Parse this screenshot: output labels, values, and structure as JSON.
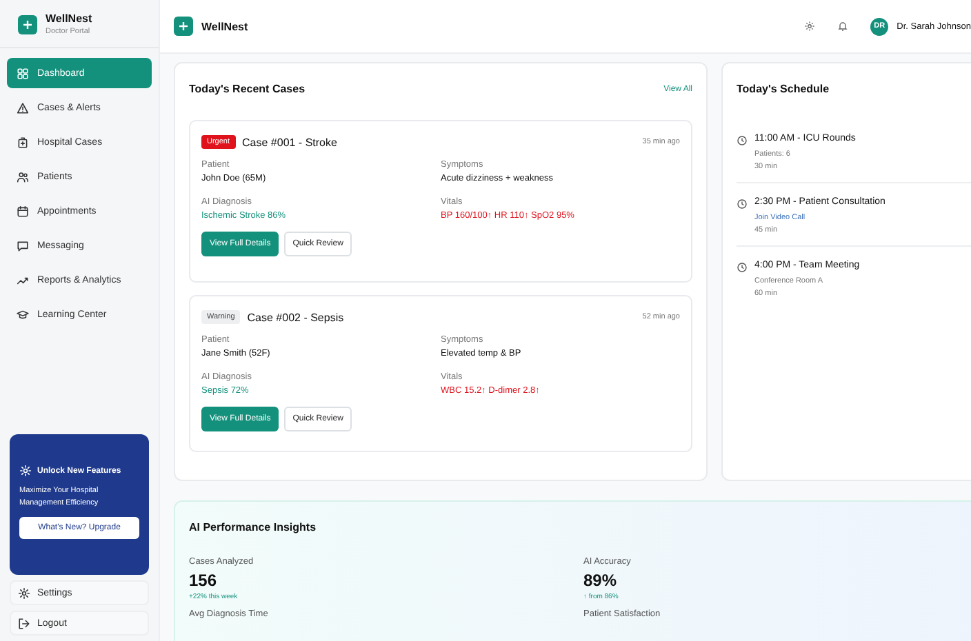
{
  "brand": {
    "name": "WellNest",
    "subtitle": "Doctor Portal"
  },
  "nav": [
    {
      "label": "Dashboard",
      "selected": true
    },
    {
      "label": "Cases & Alerts",
      "selected": false
    },
    {
      "label": "Hospital Cases",
      "selected": false
    },
    {
      "label": "Patients",
      "selected": false
    },
    {
      "label": "Appointments",
      "selected": false
    },
    {
      "label": "Messaging",
      "selected": false
    },
    {
      "label": "Reports & Analytics",
      "selected": false
    },
    {
      "label": "Learning Center",
      "selected": false
    }
  ],
  "promo": {
    "title": "Unlock New Features",
    "text": "Maximize Your Hospital Management Efficiency",
    "button": "What's New? Upgrade"
  },
  "footer_items": [
    "Settings",
    "Logout"
  ],
  "header": {
    "title": "WellNest",
    "avatar": "DR",
    "user": "Dr. Sarah Johnson"
  },
  "recent_cases": {
    "title": "Today's Recent Cases",
    "link": "View All",
    "cases": [
      {
        "kind": "urgent",
        "badge": "Urgent",
        "title": "Case #001 - Stroke",
        "time": "35 min ago",
        "fields": [
          {
            "label": "Patient",
            "value": "John Doe (65M)",
            "kind": "normal"
          },
          {
            "label": "Symptoms",
            "value": "Acute dizziness + weakness",
            "kind": "normal"
          },
          {
            "label": "AI Diagnosis",
            "value": "Ischemic Stroke 86%",
            "kind": "ai"
          },
          {
            "label": "Vitals",
            "value": "BP 160/100↑ HR 110↑ SpO2 95%",
            "kind": "alert"
          }
        ],
        "primary": "View Full Details",
        "secondary": "Quick Review"
      },
      {
        "kind": "warning",
        "badge": "Warning",
        "title": "Case #002 - Sepsis",
        "time": "52 min ago",
        "fields": [
          {
            "label": "Patient",
            "value": "Jane Smith (52F)",
            "kind": "normal"
          },
          {
            "label": "Symptoms",
            "value": "Elevated temp & BP",
            "kind": "normal"
          },
          {
            "label": "AI Diagnosis",
            "value": "Sepsis 72%",
            "kind": "ai"
          },
          {
            "label": "Vitals",
            "value": "WBC 15.2↑ D-dimer 2.8↑",
            "kind": "alert"
          }
        ],
        "primary": "View Full Details",
        "secondary": "Quick Review"
      }
    ]
  },
  "schedule": {
    "title": "Today's Schedule",
    "events": [
      {
        "title": "11:00 AM - ICU Rounds",
        "detail": "Patients: 6",
        "kind": "plain",
        "duration": "30 min"
      },
      {
        "title": "2:30 PM - Patient Consultation",
        "detail": "Join Video Call",
        "kind": "link",
        "duration": "45 min"
      },
      {
        "title": "4:00 PM - Team Meeting",
        "detail": "Conference Room A",
        "kind": "plain",
        "duration": "60 min"
      }
    ]
  },
  "insights": {
    "title": "AI Performance Insights",
    "metrics": [
      {
        "label": "Cases Analyzed",
        "value": "156",
        "change": "+22% this week"
      },
      {
        "label": "AI Accuracy",
        "value": "89%",
        "change": "↑ from 86%"
      },
      {
        "label": "Avg Diagnosis Time"
      },
      {
        "label": "Patient Satisfaction"
      }
    ]
  }
}
